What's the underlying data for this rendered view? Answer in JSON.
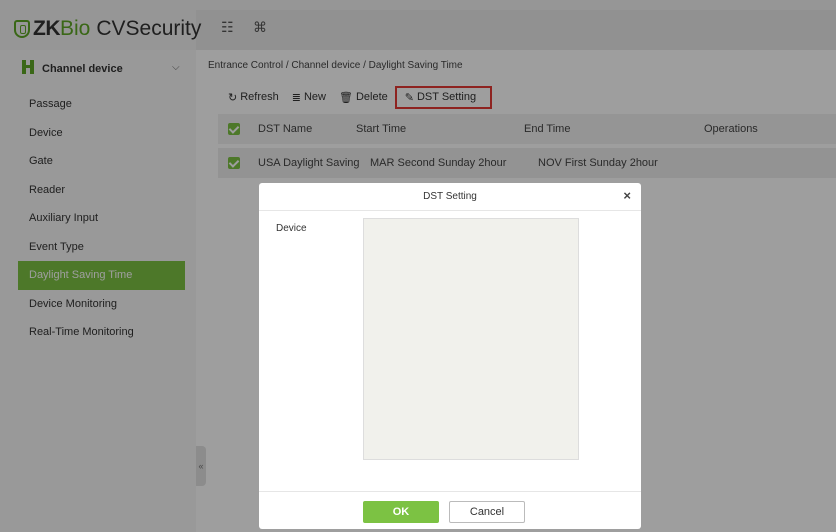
{
  "app": {
    "logo_zk": "ZK",
    "logo_bio": "Bio",
    "logo_product": "CVSecurity",
    "grid_icon": "grid-icon",
    "command_icon": "command-icon"
  },
  "sidebar": {
    "module_label": "Channel device",
    "items": [
      {
        "label": "Passage"
      },
      {
        "label": "Device"
      },
      {
        "label": "Gate"
      },
      {
        "label": "Reader"
      },
      {
        "label": "Auxiliary Input"
      },
      {
        "label": "Event Type"
      },
      {
        "label": "Daylight Saving Time",
        "active": true
      },
      {
        "label": "Device Monitoring"
      },
      {
        "label": "Real-Time Monitoring"
      }
    ],
    "collapse_glyph": "«"
  },
  "breadcrumb": "Entrance Control / Channel device / Daylight Saving Time",
  "toolbar": {
    "refresh": "Refresh",
    "new": "New",
    "delete": "Delete",
    "dst_setting": "DST Setting"
  },
  "table": {
    "columns": [
      "DST Name",
      "Start Time",
      "End Time",
      "Operations"
    ],
    "rows": [
      {
        "name": "USA Daylight Saving",
        "start": "MAR Second Sunday 2hour",
        "end": "NOV First Sunday 2hour",
        "operations": ""
      }
    ]
  },
  "dialog": {
    "title": "DST Setting",
    "close": "×",
    "device_label": "Device",
    "ok": "OK",
    "cancel": "Cancel"
  },
  "colors": {
    "accent": "#7cc243",
    "highlight": "#e53935"
  }
}
